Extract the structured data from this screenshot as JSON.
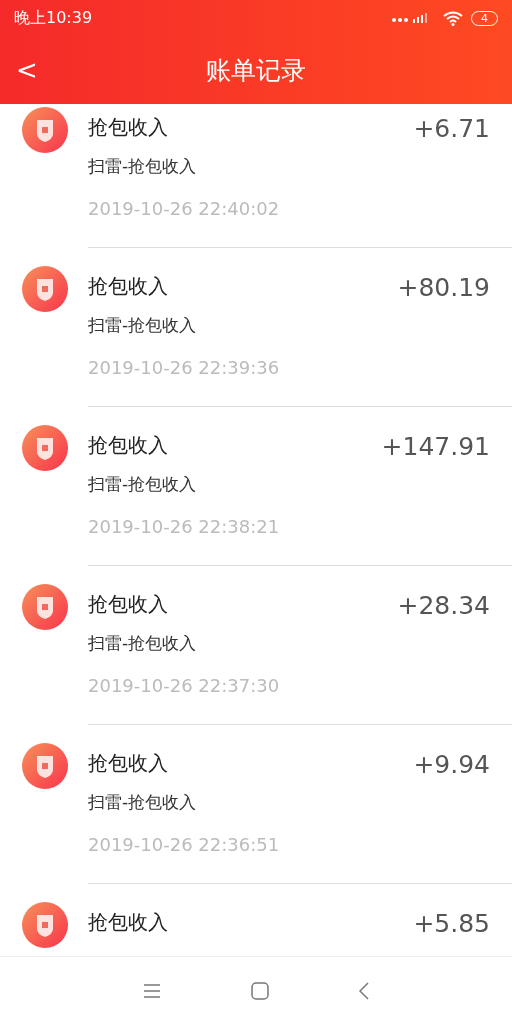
{
  "status_bar": {
    "time": "晚上10:39",
    "battery": "4"
  },
  "header": {
    "back": "<",
    "title": "账单记录"
  },
  "records": [
    {
      "title": "抢包收入",
      "amount": "+6.71",
      "subtitle": "扫雷-抢包收入",
      "time": "2019-10-26 22:40:02"
    },
    {
      "title": "抢包收入",
      "amount": "+80.19",
      "subtitle": "扫雷-抢包收入",
      "time": "2019-10-26 22:39:36"
    },
    {
      "title": "抢包收入",
      "amount": "+147.91",
      "subtitle": "扫雷-抢包收入",
      "time": "2019-10-26 22:38:21"
    },
    {
      "title": "抢包收入",
      "amount": "+28.34",
      "subtitle": "扫雷-抢包收入",
      "time": "2019-10-26 22:37:30"
    },
    {
      "title": "抢包收入",
      "amount": "+9.94",
      "subtitle": "扫雷-抢包收入",
      "time": "2019-10-26 22:36:51"
    },
    {
      "title": "抢包收入",
      "amount": "+5.85"
    }
  ]
}
